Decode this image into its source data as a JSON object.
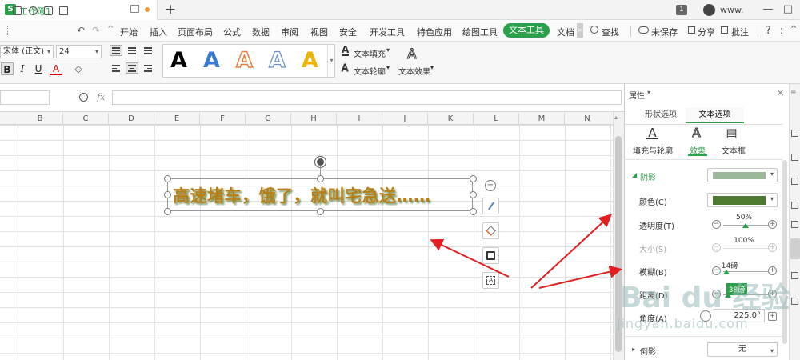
{
  "title_bar": {
    "doc_tab_label": "工作簿1",
    "logo_letter": "S",
    "page_badge": "1",
    "user_name": "www.",
    "win_controls": [
      "—",
      "□"
    ]
  },
  "menu": {
    "items": [
      "开始",
      "插入",
      "页面布局",
      "公式",
      "数据",
      "审阅",
      "视图",
      "安全",
      "开发工具",
      "特色应用",
      "绘图工具",
      "文本工具",
      "文档"
    ],
    "search_label": "查找",
    "unsaved_label": "未保存",
    "share_label": "分享",
    "comment_label": "批注",
    "help_label": "?",
    "more_label": ":",
    "caret": "^",
    "scroll_arrow": ">"
  },
  "ribbon": {
    "font_name": "宋体 (正文)",
    "font_size": "24",
    "bold": "B",
    "italic": "I",
    "underline": "U",
    "font_color": "A",
    "clear_format": "◇",
    "style_letters": [
      "A",
      "A",
      "A",
      "A",
      "A"
    ],
    "text_fill_label": "文本填充",
    "text_outline_label": "文本轮廓",
    "text_effect_label": "文本效果",
    "dropdown_arrow": "▾",
    "effect_letter": "A"
  },
  "formula_bar": {
    "fx": "fx"
  },
  "sheet": {
    "columns": [
      "B",
      "C",
      "D",
      "E",
      "F",
      "G",
      "H",
      "I",
      "J",
      "K",
      "L",
      "M",
      "N"
    ],
    "textbox_text": "高速堵车，饿了，就叫宅急送……"
  },
  "float_toolbar": {
    "collapse": "−"
  },
  "panel": {
    "title": "属性",
    "close": "×",
    "tabs": [
      "形状选项",
      "文本选项"
    ],
    "subtabs": [
      "填充与轮廓",
      "效果",
      "文本框"
    ],
    "subtab_icons": [
      "A",
      "A",
      "▤"
    ],
    "shadow_label": "阴影",
    "shadow_expand": "◢",
    "color_label": "颜色(C)",
    "transparency_label": "透明度(T)",
    "transparency_value": "50%",
    "transparency_fraction": 0.5,
    "size_label": "大小(S)",
    "size_value": "100%",
    "blur_label": "模糊(B)",
    "blur_value": "14磅",
    "distance_label": "距离(D)",
    "distance_value": "38磅",
    "angle_label": "角度(A)",
    "angle_value": "225.0°",
    "reflection_label": "倒影",
    "reflection_expand": "▸",
    "reflection_value": "无",
    "minus": "−",
    "plus": "+"
  },
  "watermark": {
    "logo": "Bai du 经验",
    "sub": "jingyan.baidu.com"
  },
  "colors": {
    "accent": "#2aa04a",
    "text_fill": "#b97f17",
    "shadow_color": "#4e7a30",
    "shadow_preview": "#9cb89a",
    "arrow": "#e02020",
    "style_blue": "#3a7ad0",
    "style_orange": "#ec8040",
    "style_yellow": "#f0b400"
  }
}
